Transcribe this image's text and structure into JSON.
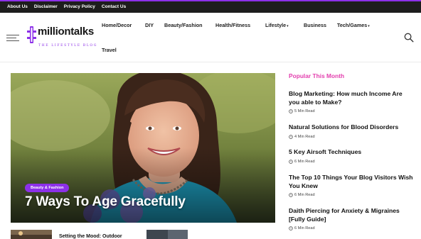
{
  "topbar": {
    "links": [
      "About Us",
      "Disclaimer",
      "Privacy Policy",
      "Contact Us"
    ]
  },
  "logo": {
    "name": "milliontalks",
    "tagline": "THE LIFESTYLE BLOG"
  },
  "nav": {
    "home_decor": "Home/Decor",
    "diy": "DIY",
    "beauty_fashion": "Beauty/Fashion",
    "health_fitness": "Health/Fitness",
    "lifestyle": "Lifestyle",
    "business": "Business",
    "tech_games": "Tech/Games",
    "travel": "Travel",
    "caret": "▾"
  },
  "hero": {
    "category": "Beauty & Fashion",
    "title": "7 Ways To Age Gracefully"
  },
  "popular": {
    "heading": "Popular This Month",
    "items": [
      {
        "title": "Blog Marketing: How much Income Are you able to Make?",
        "read": "5 Min Read"
      },
      {
        "title": "Natural Solutions for Blood Disorders",
        "read": "4 Min Read"
      },
      {
        "title": "5 Key Airsoft Techniques",
        "read": "6 Min Read"
      },
      {
        "title": "The Top 10 Things Your Blog Visitors Wish You Knew",
        "read": "6 Min Read"
      },
      {
        "title": "Daith Piercing for Anxiety & Migraines [Fully Guide]",
        "read": "6 Min Read"
      }
    ]
  },
  "bottom": {
    "article_title": "Setting the Mood: Outdoor"
  },
  "colors": {
    "accent": "#8c30e8",
    "popular_heading": "#e33fae",
    "topbar": "#1d1d1d"
  },
  "icons": [
    "hamburger-icon",
    "search-icon",
    "clock-icon",
    "chevron-down-icon"
  ]
}
